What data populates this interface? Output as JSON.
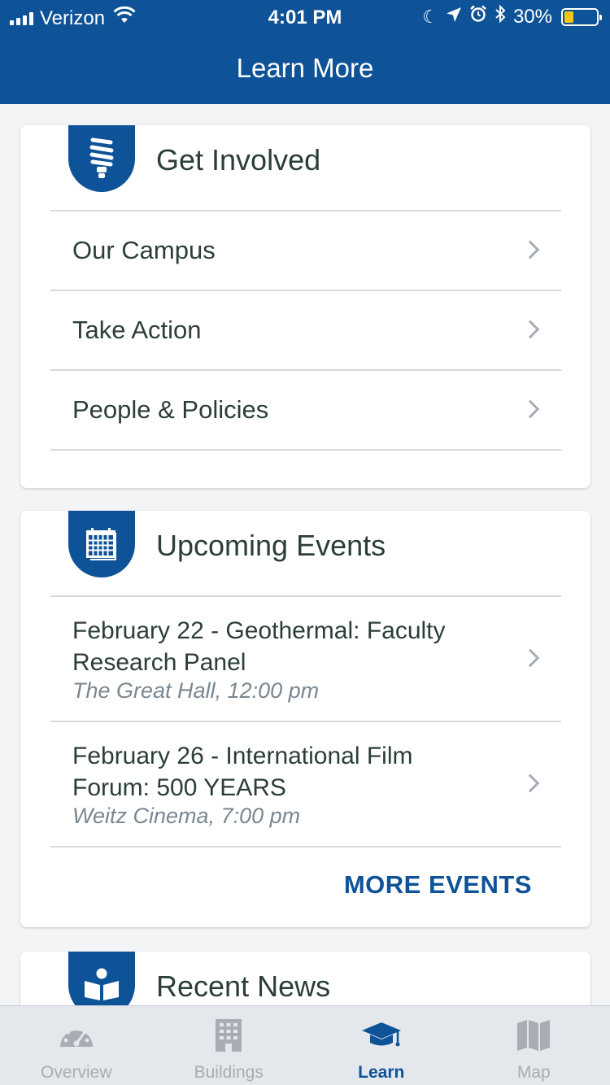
{
  "status_bar": {
    "carrier": "Verizon",
    "time": "4:01 PM",
    "battery_text": "30%",
    "battery_level": 0.3,
    "icons": [
      "signal-icon",
      "wifi-icon",
      "moon-icon",
      "location-arrow-icon",
      "alarm-icon",
      "bluetooth-icon",
      "battery-icon"
    ]
  },
  "nav": {
    "title": "Learn More"
  },
  "get_involved": {
    "title": "Get Involved",
    "icon": "lightbulb-icon",
    "items": [
      {
        "label": "Our Campus"
      },
      {
        "label": "Take Action"
      },
      {
        "label": "People & Policies"
      }
    ]
  },
  "events": {
    "title": "Upcoming Events",
    "icon": "calendar-icon",
    "items": [
      {
        "title": "February 22 - Geothermal: Faculty Research Panel",
        "subtitle": "The Great Hall, 12:00 pm"
      },
      {
        "title": "February 26 - International Film Forum: 500 YEARS",
        "subtitle": "Weitz Cinema, 7:00 pm"
      }
    ],
    "more_label": "MORE EVENTS"
  },
  "news": {
    "title": "Recent News",
    "icon": "reader-book-icon"
  },
  "tabs": [
    {
      "label": "Overview",
      "icon": "gauge-icon",
      "active": false
    },
    {
      "label": "Buildings",
      "icon": "building-icon",
      "active": false
    },
    {
      "label": "Learn",
      "icon": "graduation-cap-icon",
      "active": true
    },
    {
      "label": "Map",
      "icon": "map-icon",
      "active": false
    }
  ],
  "colors": {
    "brand": "#0e5298",
    "battery": "#f5c518",
    "inactive_tab": "#a7adb3",
    "chevron": "#a4acb6"
  }
}
